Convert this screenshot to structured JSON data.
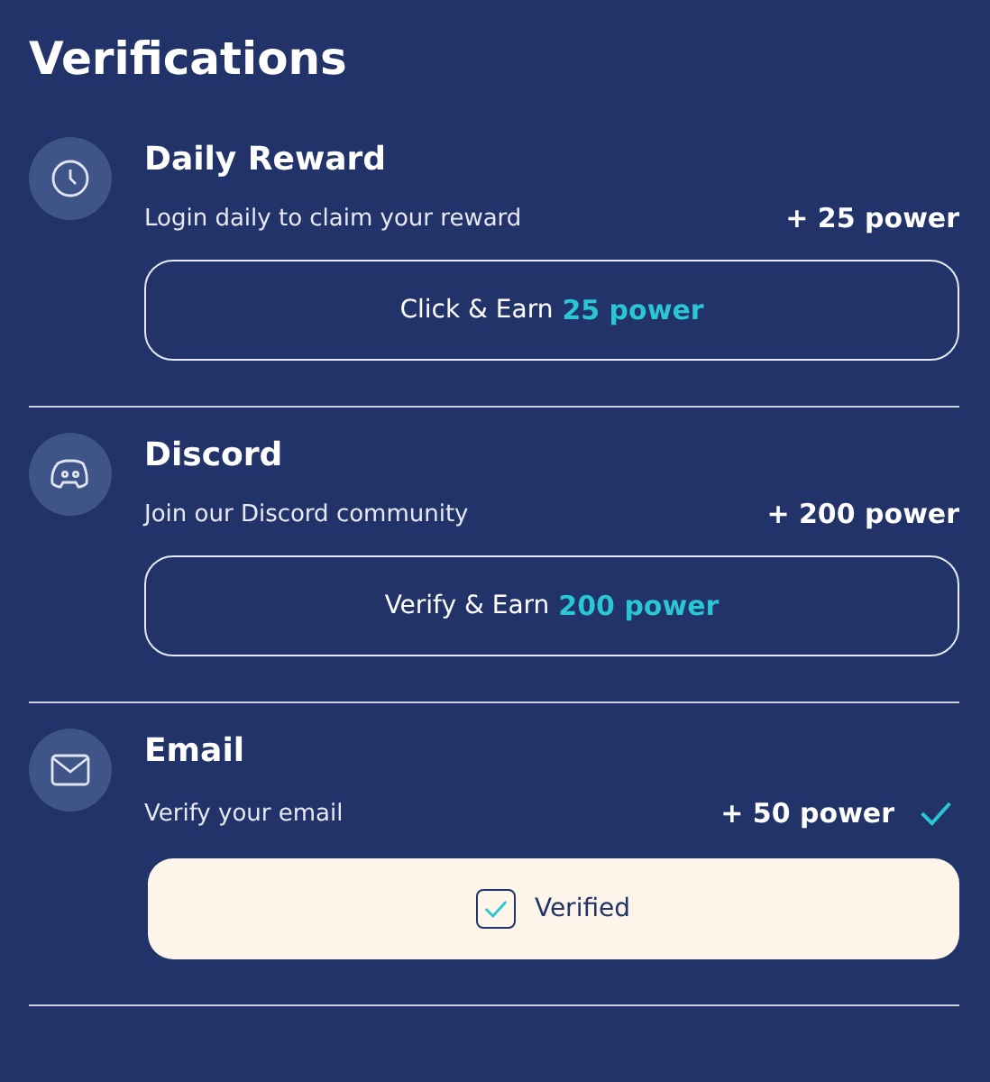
{
  "title": "Verifications",
  "items": [
    {
      "kind": "clock",
      "title": "Daily Reward",
      "description": "Login daily to claim your reward",
      "reward": "+ 25 power",
      "verified": false,
      "button": {
        "label": "Click & Earn",
        "highlight": "25 power"
      }
    },
    {
      "kind": "discord",
      "title": "Discord",
      "description": "Join our Discord community",
      "reward": "+ 200 power",
      "verified": false,
      "button": {
        "label": "Verify & Earn",
        "highlight": "200 power"
      }
    },
    {
      "kind": "email",
      "title": "Email",
      "description": "Verify your email",
      "reward": "+ 50 power",
      "verified": true,
      "button": {
        "label": "Verified"
      }
    }
  ]
}
